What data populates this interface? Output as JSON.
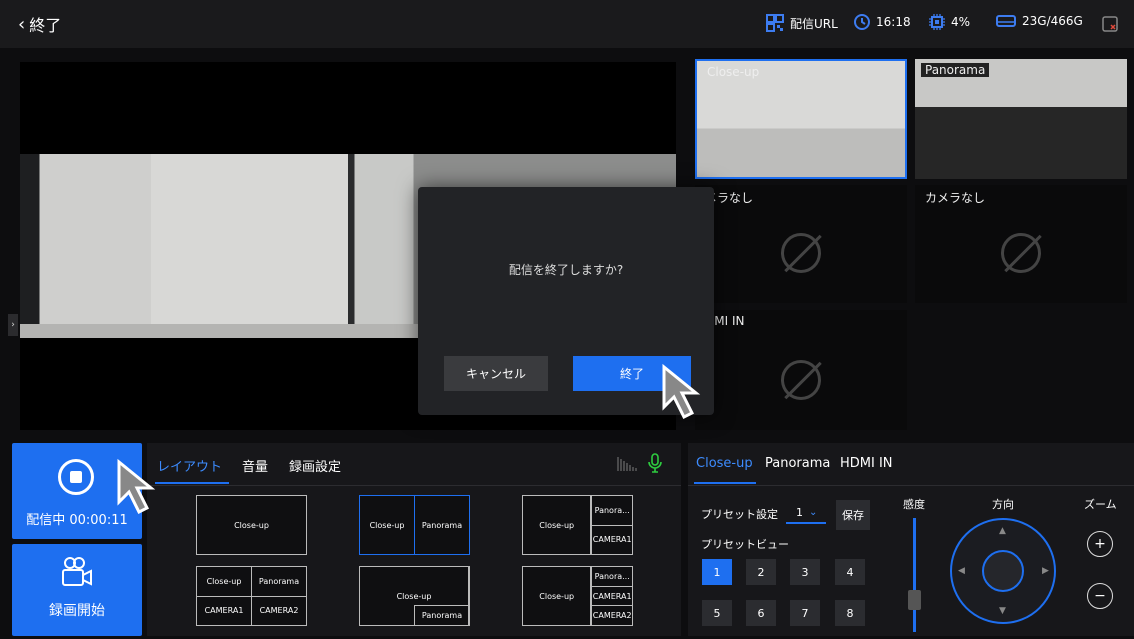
{
  "topbar": {
    "back_label": "終了",
    "stream_url_label": "配信URL",
    "time": "16:18",
    "cpu": "4%",
    "storage": "23G/466G"
  },
  "preview_tiles": [
    {
      "label": "Close-up"
    },
    {
      "label": "Panorama"
    },
    {
      "label": "メラなし"
    },
    {
      "label": "カメラなし"
    },
    {
      "label": "DMI IN"
    }
  ],
  "dialog": {
    "message": "配信を終了しますか?",
    "cancel_label": "キャンセル",
    "confirm_label": "終了"
  },
  "left_buttons": {
    "streaming_label": "配信中 00:00:11",
    "record_label": "録画開始"
  },
  "center_tabs": [
    "レイアウト",
    "音量",
    "録画設定"
  ],
  "layouts": [
    {
      "cells": [
        "Close-up"
      ]
    },
    {
      "cells": [
        "Close-up",
        "Panorama"
      ]
    },
    {
      "main": "Close-up",
      "side": [
        "Panora...",
        "CAMERA1"
      ]
    },
    {
      "grid": [
        "Close-up",
        "Panorama",
        "CAMERA1",
        "CAMERA2"
      ]
    },
    {
      "main": "Close-up",
      "pip": "Panorama"
    },
    {
      "main": "Close-up",
      "side": [
        "Panora...",
        "CAMERA1",
        "CAMERA2"
      ]
    }
  ],
  "right_tabs": [
    "Close-up",
    "Panorama",
    "HDMI IN"
  ],
  "camera_control": {
    "preset_setting_label": "プリセット設定",
    "preset_value": "1",
    "save_label": "保存",
    "preset_view_label": "プリセットビュー",
    "preset_buttons": [
      "1",
      "2",
      "3",
      "4",
      "5",
      "6",
      "7",
      "8"
    ],
    "selected_preset": "1",
    "sensitivity_label": "感度",
    "direction_label": "方向",
    "zoom_label": "ズーム"
  },
  "colors": {
    "accent": "#1e6ff0",
    "mic": "#2ecc40"
  }
}
